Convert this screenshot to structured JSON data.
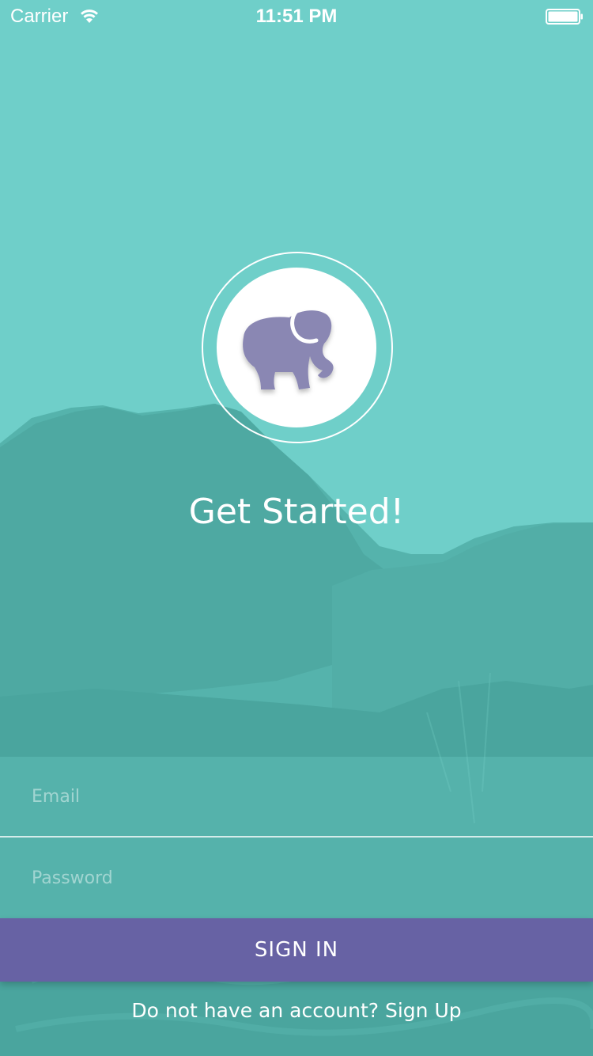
{
  "status_bar": {
    "carrier": "Carrier",
    "time": "11:51 PM"
  },
  "icons": {
    "wifi": "wifi-icon",
    "battery": "battery-icon",
    "logo": "elephant-icon"
  },
  "colors": {
    "background": "#6fcfc9",
    "mountains": "#4faaa3",
    "button": "#6762a4",
    "elephant": "#8a87b3"
  },
  "title": "Get Started!",
  "form": {
    "email_placeholder": "Email",
    "email_value": "",
    "password_placeholder": "Password",
    "password_value": ""
  },
  "sign_in_label": "SIGN IN",
  "signup_prompt": "Do not have an account? Sign Up"
}
